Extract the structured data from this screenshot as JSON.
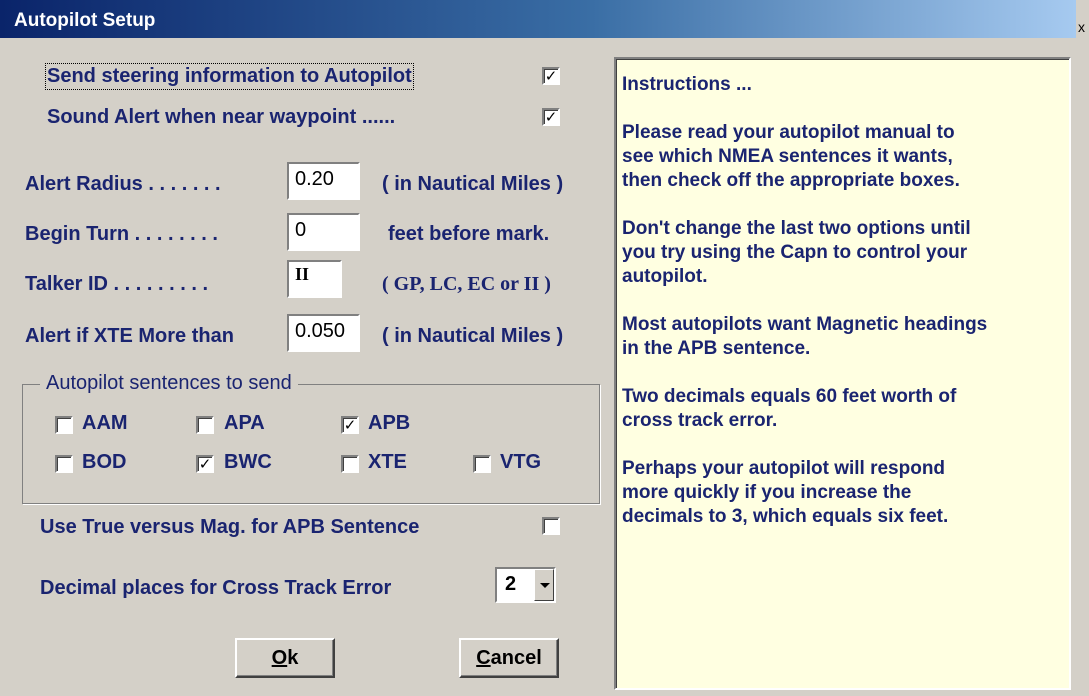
{
  "window": {
    "title": "Autopilot Setup",
    "close_label": "x"
  },
  "options": {
    "send_steering": {
      "label": "Send steering information to Autopilot",
      "checked": true
    },
    "sound_alert": {
      "label": "Sound Alert when near waypoint ......",
      "checked": true
    }
  },
  "fields": {
    "alert_radius": {
      "label": "Alert Radius . . . . . . .",
      "value": "0.20",
      "unit": "( in Nautical Miles )"
    },
    "begin_turn": {
      "label": "Begin Turn . . . . . . . .",
      "value": "0",
      "unit": "feet before mark."
    },
    "talker_id": {
      "label": "Talker ID . . . . . . . . .",
      "value": "II",
      "unit": "( GP, LC, EC or II )"
    },
    "alert_xte": {
      "label": "Alert if XTE More than",
      "value": "0.050",
      "unit": "( in Nautical Miles )"
    }
  },
  "sentences": {
    "group_title": "Autopilot sentences to send",
    "items": [
      {
        "label": "AAM",
        "checked": false
      },
      {
        "label": "APA",
        "checked": false
      },
      {
        "label": "APB",
        "checked": true
      },
      {
        "label": "BOD",
        "checked": false
      },
      {
        "label": "BWC",
        "checked": true
      },
      {
        "label": "XTE",
        "checked": false
      },
      {
        "label": "VTG",
        "checked": false
      }
    ]
  },
  "true_vs_mag": {
    "label": "Use True versus Mag. for APB Sentence",
    "checked": false
  },
  "decimal_places": {
    "label": "Decimal places for Cross Track Error",
    "value": "2"
  },
  "buttons": {
    "ok": {
      "mnemonic": "O",
      "rest": "k"
    },
    "cancel": {
      "mnemonic": "C",
      "rest": "ancel"
    }
  },
  "instructions": {
    "paragraphs": [
      "Instructions ...",
      "Please read your autopilot manual to\nsee which NMEA sentences it wants,\nthen check off the appropriate boxes.",
      "Don't change the last two options until\nyou try using the Capn to control your\nautopilot.",
      "Most autopilots want Magnetic headings\nin the APB sentence.",
      "Two decimals equals 60 feet worth of\ncross track error.",
      "Perhaps your autopilot will respond\nmore quickly if you increase the\ndecimals to 3, which equals six feet."
    ]
  },
  "colors": {
    "title_bar": "#0a246a",
    "label_text": "#1a2470",
    "dialog_bg": "#d4d0c8",
    "instructions_bg": "#ffffe1"
  }
}
